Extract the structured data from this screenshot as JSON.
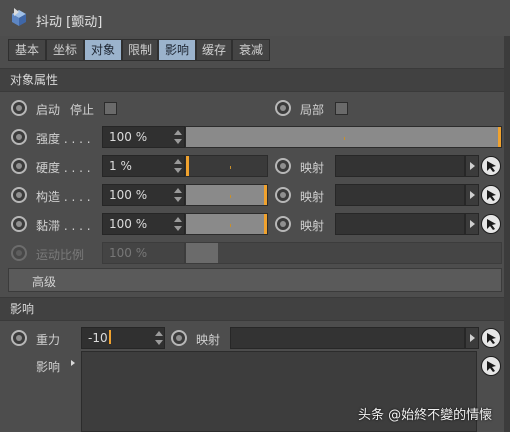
{
  "window": {
    "title": "抖动 [颤动]",
    "icon": "cube-object-icon"
  },
  "tabs": [
    {
      "label": "基本",
      "active": false
    },
    {
      "label": "坐标",
      "active": false
    },
    {
      "label": "对象",
      "active": true
    },
    {
      "label": "限制",
      "active": false
    },
    {
      "label": "影响",
      "active": true
    },
    {
      "label": "缓存",
      "active": false
    },
    {
      "label": "衰减",
      "active": false
    }
  ],
  "object_props": {
    "section_title": "对象属性",
    "start_label": "启动",
    "stop_label": "停止",
    "local_label": "局部",
    "intensity": {
      "label": "强度 . . . .",
      "value": "100 %",
      "level": 1.0
    },
    "stiffness": {
      "label": "硬度 . . . .",
      "value": "1 %",
      "level": 0.01,
      "map_label": "映射"
    },
    "structure": {
      "label": "构造 . . . .",
      "value": "100 %",
      "level": 1.0,
      "map_label": "映射"
    },
    "viscosity": {
      "label": "黏滞 . . . .",
      "value": "100 %",
      "level": 1.0,
      "map_label": "映射"
    },
    "motion_ratio": {
      "label": "运动比例",
      "value": "100 %",
      "level": 0.1
    }
  },
  "advanced": {
    "label": "高级"
  },
  "influence": {
    "section_title": "影响",
    "gravity_label": "重力",
    "gravity_value": "-10",
    "map_label": "映射",
    "influence_label": "影响"
  },
  "watermark": "头条 @始終不變的情懐",
  "colors": {
    "accent": "#f0a22e",
    "active_tab": "#9bb3cc"
  }
}
